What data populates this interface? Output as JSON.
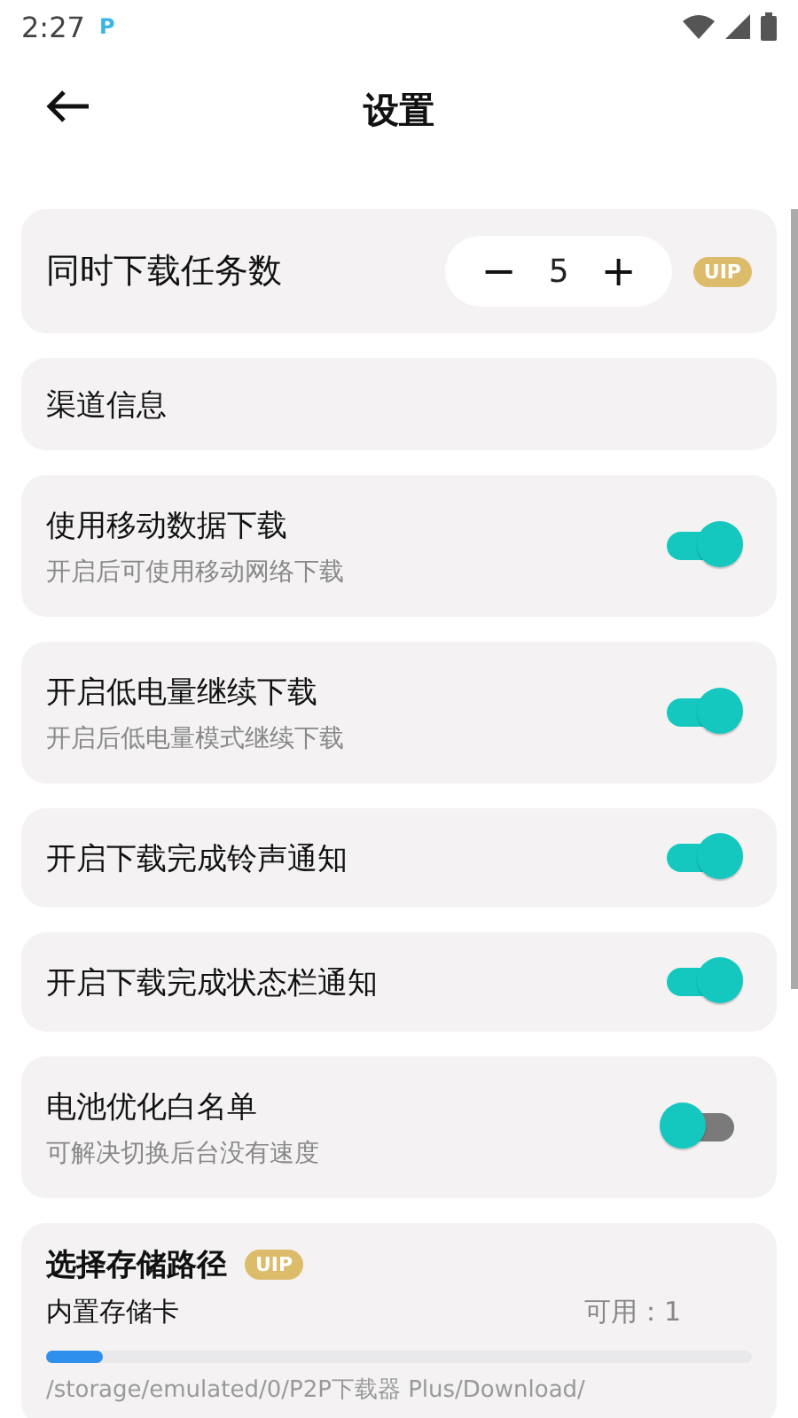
{
  "status_bar": {
    "time": "2:27",
    "app_badge": "P"
  },
  "header": {
    "title": "设置"
  },
  "task_count": {
    "label": "同时下载任务数",
    "minus": "−",
    "value": "5",
    "plus": "+",
    "badge": "UIP"
  },
  "channel": {
    "label": "渠道信息"
  },
  "toggles": [
    {
      "label": "使用移动数据下载",
      "hint": "开启后可使用移动网络下载",
      "on": true
    },
    {
      "label": "开启低电量继续下载",
      "hint": "开启后低电量模式继续下载",
      "on": true
    },
    {
      "label": "开启下载完成铃声通知",
      "on": true
    },
    {
      "label": "开启下载完成状态栏通知",
      "on": true
    },
    {
      "label": "电池优化白名单",
      "hint": "可解决切换后台没有速度",
      "on": false
    }
  ],
  "storage": {
    "title": "选择存储路径",
    "badge": "UIP",
    "device": "内置存储卡",
    "available": "可用：1",
    "level": 0.08,
    "path": "/storage/emulated/0/P2P下载器 Plus/Download/"
  }
}
